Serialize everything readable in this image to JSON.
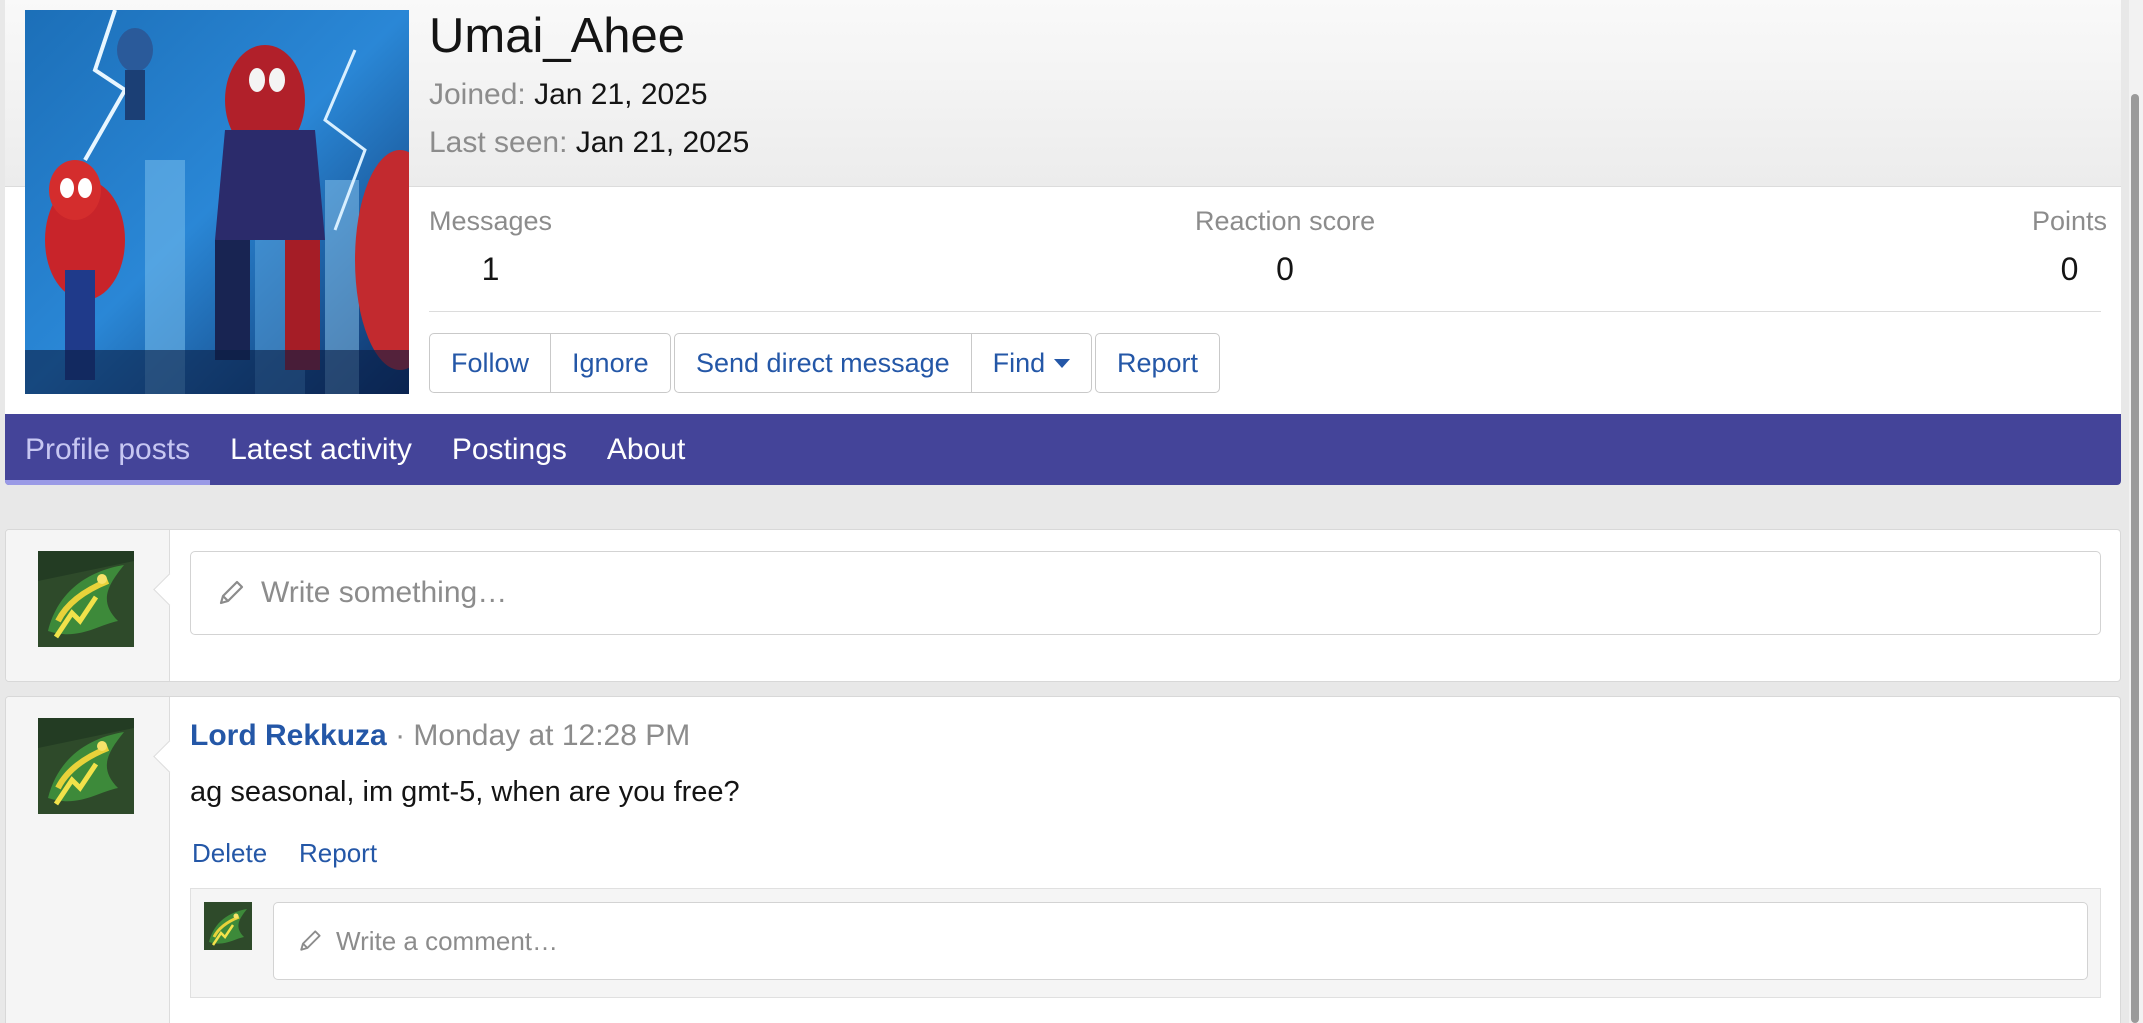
{
  "profile": {
    "username": "Umai_Ahee",
    "joined_label": "Joined:",
    "joined_value": "Jan 21, 2025",
    "last_seen_label": "Last seen:",
    "last_seen_value": "Jan 21, 2025",
    "avatar_icon": "spider-man-avatar-image"
  },
  "stats": {
    "messages_label": "Messages",
    "messages_value": "1",
    "reaction_label": "Reaction score",
    "reaction_value": "0",
    "points_label": "Points",
    "points_value": "0"
  },
  "actions": {
    "follow": "Follow",
    "ignore": "Ignore",
    "send_dm": "Send direct message",
    "find": "Find",
    "report": "Report"
  },
  "tabs": [
    {
      "label": "Profile posts",
      "active": true
    },
    {
      "label": "Latest activity",
      "active": false
    },
    {
      "label": "Postings",
      "active": false
    },
    {
      "label": "About",
      "active": false
    }
  ],
  "composer": {
    "placeholder": "Write something…",
    "icon": "pencil-icon"
  },
  "post": {
    "author": "Lord Rekkuza",
    "separator": "·",
    "time": "Monday at 12:28 PM",
    "text": "ag seasonal, im gmt-5, when are you free?",
    "delete_label": "Delete",
    "report_label": "Report",
    "comment_placeholder": "Write a comment…",
    "avatar_icon": "rayquaza-avatar-image"
  },
  "colors": {
    "tabbar": "#444499",
    "link": "#2457a7",
    "muted": "#8c8c8c",
    "active_tab_text": "#c7c7f2"
  }
}
